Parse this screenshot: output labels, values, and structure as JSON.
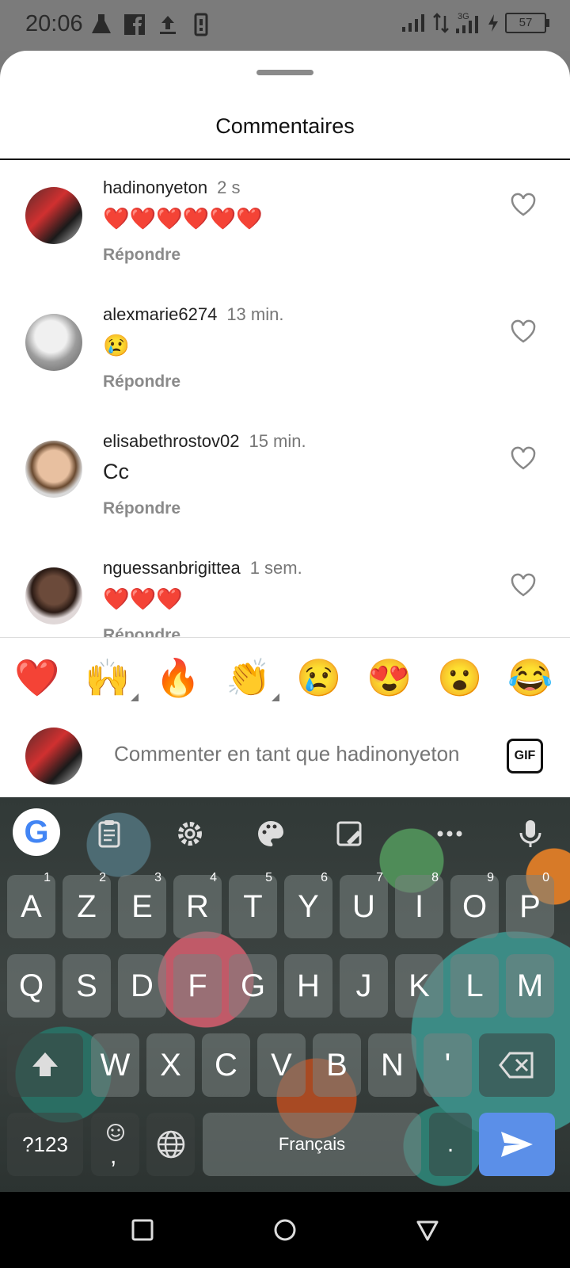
{
  "status_bar": {
    "time": "20:06",
    "battery": "57"
  },
  "sheet": {
    "title": "Commentaires"
  },
  "comments": [
    {
      "username": "hadinonyeton",
      "time": "2 s",
      "text": "❤️❤️❤️❤️❤️❤️",
      "reply_label": "Répondre"
    },
    {
      "username": "alexmarie6274",
      "time": "13 min.",
      "text": "😢",
      "reply_label": "Répondre"
    },
    {
      "username": "elisabethrostov02",
      "time": "15 min.",
      "text": "Cc",
      "reply_label": "Répondre"
    },
    {
      "username": "nguessanbrigittea",
      "time": "1 sem.",
      "text": "❤️❤️❤️",
      "reply_label": "Répondre"
    }
  ],
  "emoji_bar": [
    "❤️",
    "🙌",
    "🔥",
    "👏",
    "😢",
    "😍",
    "😮",
    "😂"
  ],
  "compose": {
    "placeholder": "Commenter en tant que hadinonyeton",
    "gif_label": "GIF"
  },
  "keyboard": {
    "row1": [
      {
        "k": "A",
        "h": "1"
      },
      {
        "k": "Z",
        "h": "2"
      },
      {
        "k": "E",
        "h": "3"
      },
      {
        "k": "R",
        "h": "4"
      },
      {
        "k": "T",
        "h": "5"
      },
      {
        "k": "Y",
        "h": "6"
      },
      {
        "k": "U",
        "h": "7"
      },
      {
        "k": "I",
        "h": "8"
      },
      {
        "k": "O",
        "h": "9"
      },
      {
        "k": "P",
        "h": "0"
      }
    ],
    "row2": [
      "Q",
      "S",
      "D",
      "F",
      "G",
      "H",
      "J",
      "K",
      "L",
      "M"
    ],
    "row3": [
      "W",
      "X",
      "C",
      "V",
      "B",
      "N",
      "'"
    ],
    "symbols_label": "?123",
    "comma_label": ",",
    "space_label": "Français",
    "period_label": "."
  }
}
